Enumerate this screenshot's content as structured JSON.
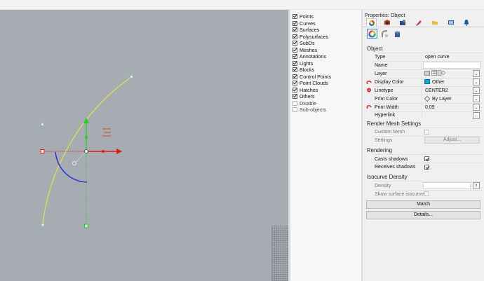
{
  "viewport": {
    "background": "#a7acb2",
    "curve_color": "#e8e040",
    "selected_color": "#1e2fd6"
  },
  "filters": [
    {
      "label": "Points",
      "checked": true
    },
    {
      "label": "Curves",
      "checked": true
    },
    {
      "label": "Surfaces",
      "checked": true
    },
    {
      "label": "Polysurfaces",
      "checked": true
    },
    {
      "label": "SubDs",
      "checked": true
    },
    {
      "label": "Meshes",
      "checked": true
    },
    {
      "label": "Annotations",
      "checked": true
    },
    {
      "label": "Lights",
      "checked": true
    },
    {
      "label": "Blocks",
      "checked": true
    },
    {
      "label": "Control Points",
      "checked": true
    },
    {
      "label": "Point Clouds",
      "checked": true
    },
    {
      "label": "Hatches",
      "checked": true
    },
    {
      "label": "Others",
      "checked": true
    },
    {
      "label": "Disable",
      "checked": false
    },
    {
      "label": "Sub-objects",
      "checked": false
    }
  ],
  "properties": {
    "title": "Properties: Object",
    "tab_icons": [
      "object-properties-icon",
      "material-icon",
      "render-icon",
      "decal-icon",
      "texture-folder-icon",
      "display-icon",
      "notification-icon"
    ],
    "sub_icons": [
      "color-wheel-icon",
      "curve-piping-icon",
      "thickness-icon"
    ],
    "object": {
      "section": "Object",
      "type_label": "Type",
      "type_value": "open curve",
      "name_label": "Name",
      "name_value": "",
      "layer_label": "Layer",
      "display_color_label": "Display Color",
      "display_color_value": "Other",
      "display_color_swatch": "#12a6e0",
      "linetype_label": "Linetype",
      "linetype_value": "CENTER2",
      "print_color_label": "Print Color",
      "print_color_value": "By Layer",
      "print_width_label": "Print Width",
      "print_width_value": "0.09",
      "hyperlink_label": "Hyperlink",
      "hyperlink_button": "..."
    },
    "render_mesh": {
      "section": "Render Mesh Settings",
      "custom_mesh_label": "Custom Mesh",
      "settings_label": "Settings",
      "adjust_button": "Adjust..."
    },
    "rendering": {
      "section": "Rendering",
      "casts_shadows_label": "Casts shadows",
      "casts_shadows": true,
      "receives_shadows_label": "Receives shadows",
      "receives_shadows": true
    },
    "isocurve": {
      "section": "Isocurve Density",
      "density_label": "Density",
      "density_value": "",
      "show_surface_label": "Show surface isocurve"
    },
    "match_button": "Match",
    "details_button": "Details..."
  }
}
